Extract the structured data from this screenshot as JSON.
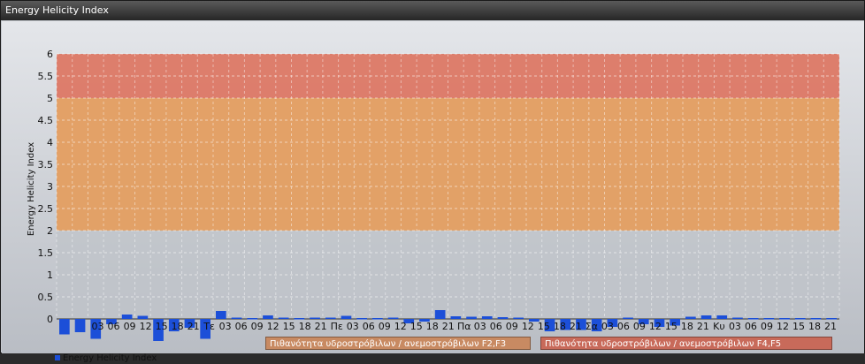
{
  "window": {
    "title": "Energy Helicity Index"
  },
  "chart_data": {
    "type": "bar",
    "ylabel": "Energy Helicity Index",
    "ylim": [
      -1,
      6
    ],
    "yticks": [
      0,
      0.5,
      1,
      1.5,
      2,
      2.5,
      3,
      3.5,
      4,
      4.5,
      5,
      5.5,
      6
    ],
    "ytick_labels": [
      "0",
      "0.5",
      "1",
      "1.5",
      "2",
      "2.5",
      "3",
      "3.5",
      "4",
      "4.5",
      "5",
      "5.5",
      "6"
    ],
    "grid": true,
    "x_tick_labels": [
      "03",
      "06",
      "09",
      "12",
      "15",
      "18",
      "21",
      "Τε",
      "03",
      "06",
      "09",
      "12",
      "15",
      "18",
      "21",
      "Πε",
      "03",
      "06",
      "09",
      "12",
      "15",
      "18",
      "21",
      "Πα",
      "03",
      "06",
      "09",
      "12",
      "15",
      "18",
      "21",
      "Σα",
      "03",
      "06",
      "09",
      "12",
      "15",
      "18",
      "21",
      "Κυ",
      "03",
      "06",
      "09",
      "12",
      "15",
      "18",
      "21"
    ],
    "bands": [
      {
        "from": 2,
        "to": 5,
        "label": "Πιθανότητα υδροστρόβιλων / ανεμοστρόβιλων F2,F3",
        "color": "#e89a55"
      },
      {
        "from": 5,
        "to": 6,
        "label": "Πιθανότητα υδροστρόβιλων / ανεμοστρόβιλων F4,F5",
        "color": "#e0705a"
      }
    ],
    "series": [
      {
        "name": "Energy Helicity Index",
        "color": "#1c4fd8",
        "values": [
          -0.35,
          -0.3,
          -0.45,
          -0.12,
          0.1,
          0.07,
          -0.5,
          -0.28,
          -0.2,
          -0.45,
          0.18,
          0.03,
          0.02,
          0.08,
          0.03,
          0.02,
          0.03,
          0.03,
          0.07,
          0.02,
          0.02,
          0.03,
          -0.1,
          -0.06,
          0.2,
          0.06,
          0.05,
          0.06,
          0.04,
          0.03,
          -0.06,
          -0.28,
          -0.25,
          -0.25,
          -0.28,
          -0.18,
          0.03,
          -0.12,
          -0.18,
          -0.15,
          0.05,
          0.08,
          0.08,
          0.03,
          0.02,
          0.02,
          0.02,
          0.02,
          0.02,
          0.02
        ]
      }
    ]
  }
}
